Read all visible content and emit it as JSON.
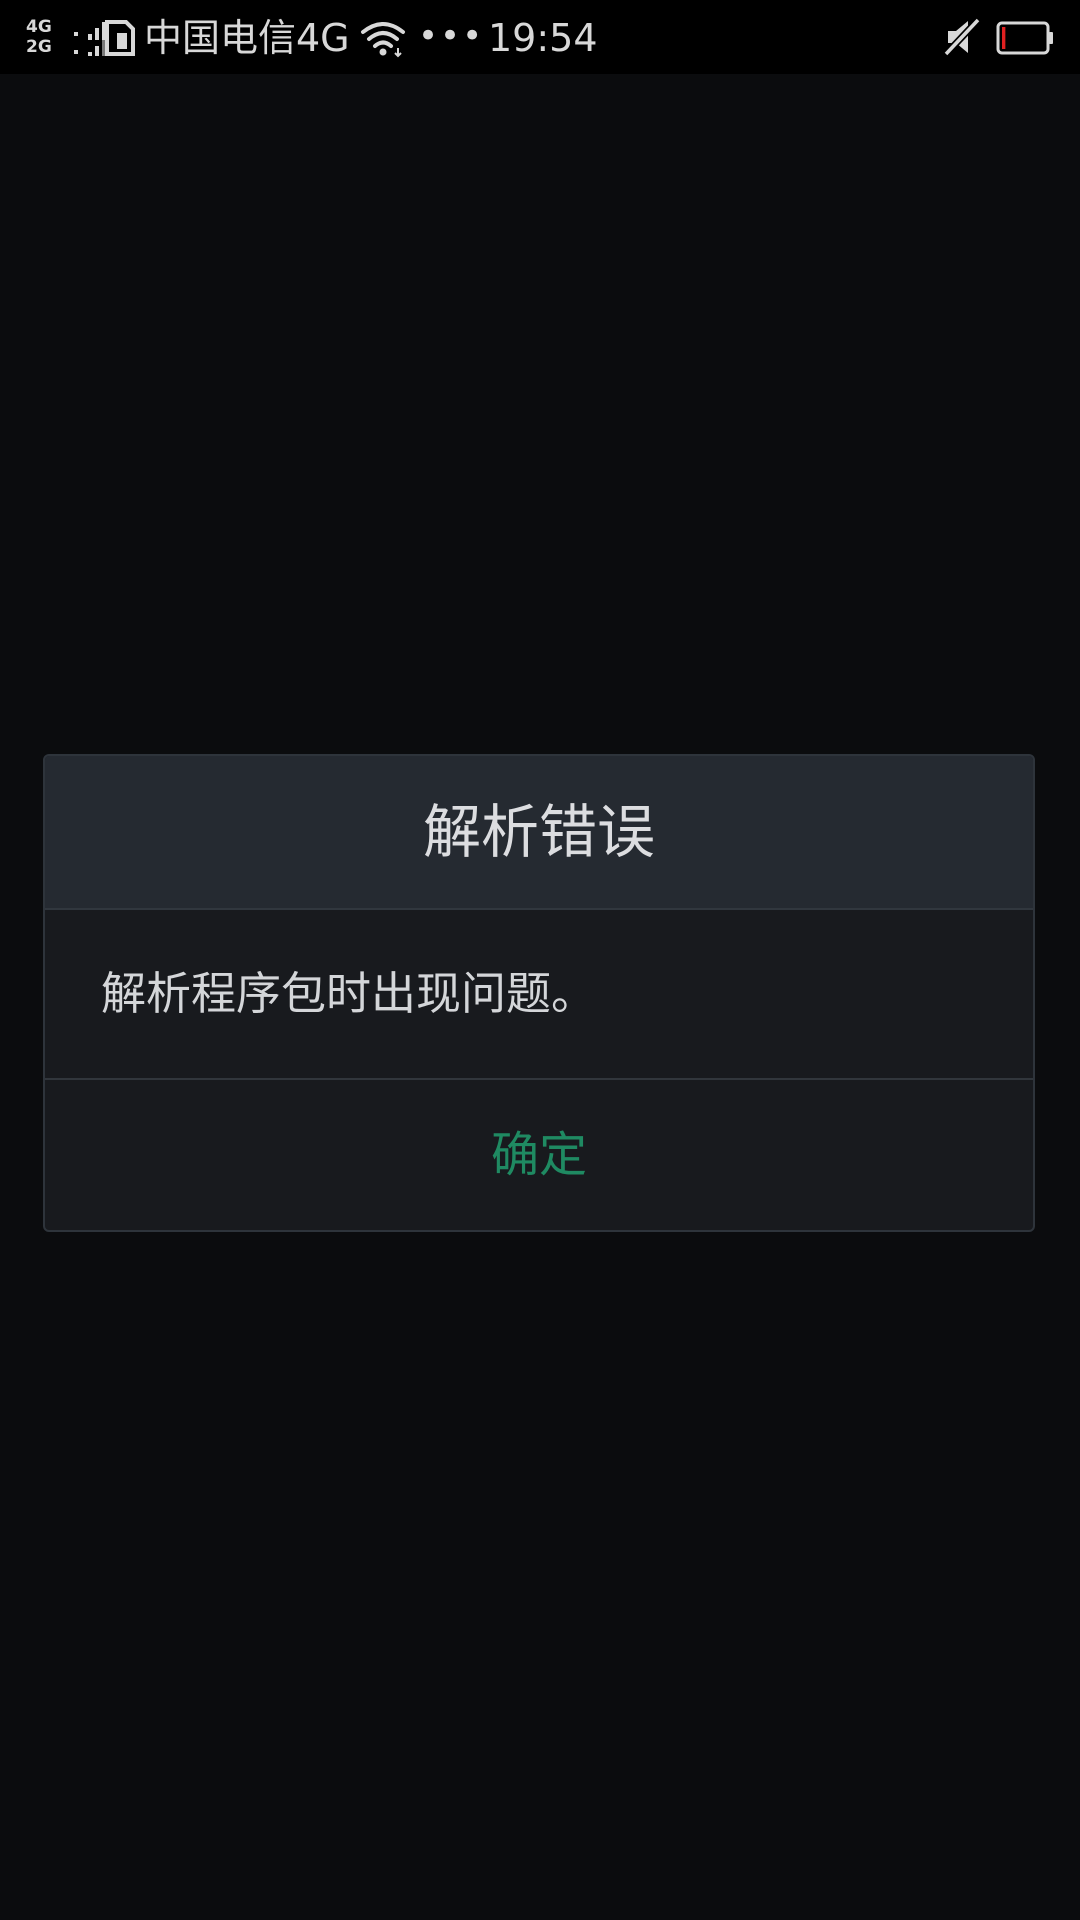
{
  "status_bar": {
    "network_top": "4G",
    "network_bottom": "2G",
    "carrier": "中国电信4G",
    "overflow_dots": "•••",
    "time": "19:54",
    "icons": [
      "signal-icon",
      "sim-icon",
      "wifi-icon",
      "mute-icon",
      "battery-icon"
    ],
    "battery_level": 0.08,
    "battery_color": "#e02020"
  },
  "dialog": {
    "title": "解析错误",
    "message": "解析程序包时出现问题。",
    "ok_label": "确定",
    "accent_color": "#1f8a62"
  }
}
